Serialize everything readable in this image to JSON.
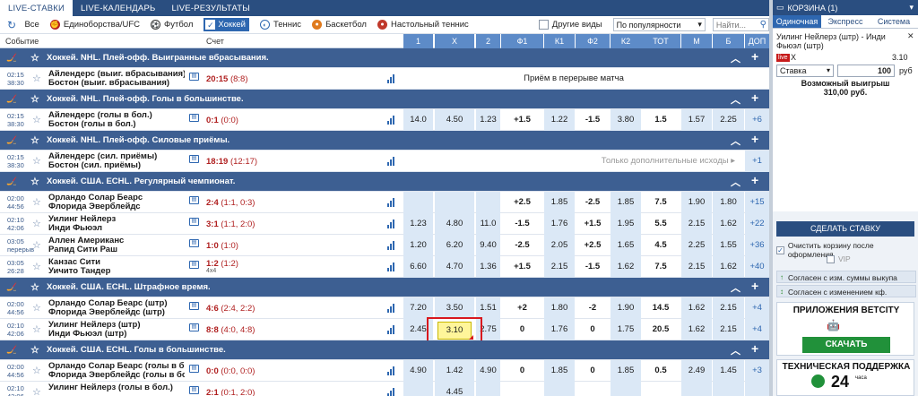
{
  "topnav": {
    "tabs": [
      "LIVE-СТАВКИ",
      "LIVE-КАЛЕНДАРЬ",
      "LIVE-РЕЗУЛЬТАТЫ"
    ]
  },
  "filters": {
    "items": [
      "Все",
      "Единоборства/UFC",
      "Футбол",
      "Хоккей",
      "Теннис",
      "Баскетбол",
      "Настольный теннис"
    ],
    "other": "Другие виды",
    "sort": "По популярности",
    "search_placeholder": "Найти..."
  },
  "columns": {
    "event": "Событие",
    "score": "Счет",
    "h": [
      "1",
      "X",
      "2",
      "Ф1",
      "К1",
      "Ф2",
      "К2",
      "ТОТ",
      "М",
      "Б",
      "ДОП"
    ]
  },
  "rows": [
    {
      "kind": "league",
      "name": "Хоккей. NHL. Плей-офф. Выигранные вбрасывания."
    },
    {
      "kind": "match",
      "t1": "02:15",
      "t2": "38:30",
      "a": "Айлендерс (выиг. вбрасывания)",
      "b": "Бостон (выиг. вбрасывания)",
      "score": "20:15",
      "sub": "(8:8)",
      "msg": "Приём в перерыве матча"
    },
    {
      "kind": "league",
      "name": "Хоккей. NHL. Плей-офф. Голы в большинстве."
    },
    {
      "kind": "match",
      "t1": "02:15",
      "t2": "38:30",
      "a": "Айлендерс (голы в бол.)",
      "b": "Бостон (голы в бол.)",
      "score": "0:1",
      "sub": "(0:0)",
      "odds": [
        "14.0",
        "4.50",
        "1.23",
        "+1.5",
        "1.22",
        "-1.5",
        "3.80",
        "1.5",
        "1.57",
        "2.25",
        "+6"
      ]
    },
    {
      "kind": "league",
      "name": "Хоккей. NHL. Плей-офф. Силовые приёмы."
    },
    {
      "kind": "match",
      "t1": "02:15",
      "t2": "38:30",
      "a": "Айлендерс (сил. приёмы)",
      "b": "Бостон (сил. приёмы)",
      "score": "18:19",
      "sub": "(12:17)",
      "more": "Только дополнительные исходы ▸",
      "extra": "+1"
    },
    {
      "kind": "league",
      "name": "Хоккей. США. ECHL. Регулярный чемпионат."
    },
    {
      "kind": "match",
      "t1": "02:00",
      "t2": "44:56",
      "a": "Орландо Солар Беарс",
      "b": "Флорида Эверблейдс",
      "score": "2:4",
      "sub": "(1:1, 0:3)",
      "odds": [
        "",
        "",
        "",
        "+2.5",
        "1.85",
        "-2.5",
        "1.85",
        "7.5",
        "1.90",
        "1.80",
        "+15"
      ]
    },
    {
      "kind": "match",
      "t1": "02:10",
      "t2": "42:06",
      "a": "Уилинг Нейлерз",
      "b": "Инди Фьюэл",
      "score": "3:1",
      "sub": "(1:1, 2:0)",
      "odds": [
        "1.23",
        "4.80",
        "11.0",
        "-1.5",
        "1.76",
        "+1.5",
        "1.95",
        "5.5",
        "2.15",
        "1.62",
        "+22"
      ]
    },
    {
      "kind": "match",
      "t1": "03:05",
      "t2": "перерыв",
      "a": "Аллен Американс",
      "b": "Рапид Сити Раш",
      "score": "1:0",
      "sub": "(1:0)",
      "odds": [
        "1.20",
        "6.20",
        "9.40",
        "-2.5",
        "2.05",
        "+2.5",
        "1.65",
        "4.5",
        "2.25",
        "1.55",
        "+36"
      ]
    },
    {
      "kind": "match",
      "t1": "03:05",
      "t2": "26:28",
      "a": "Канзас Сити",
      "b": "Уичито Тандер",
      "score": "1:2",
      "sub": "(1:2)",
      "score2": "4x4",
      "odds": [
        "6.60",
        "4.70",
        "1.36",
        "+1.5",
        "2.15",
        "-1.5",
        "1.62",
        "7.5",
        "2.15",
        "1.62",
        "+40"
      ]
    },
    {
      "kind": "league",
      "name": "Хоккей. США. ECHL. Штрафное время."
    },
    {
      "kind": "match",
      "t1": "02:00",
      "t2": "44:56",
      "a": "Орландо Солар Беарс (штр)",
      "b": "Флорида Эверблейдс (штр)",
      "score": "4:6",
      "sub": "(2:4, 2:2)",
      "odds": [
        "7.20",
        "3.50",
        "1.51",
        "+2",
        "1.80",
        "-2",
        "1.90",
        "14.5",
        "1.62",
        "2.15",
        "+4"
      ]
    },
    {
      "kind": "match",
      "t1": "02:10",
      "t2": "42:06",
      "a": "Уилинг Нейлерз (штр)",
      "b": "Инди Фьюэл (штр)",
      "score": "8:8",
      "sub": "(4:0, 4:8)",
      "odds": [
        "2.45",
        "3.10",
        "2.75",
        "0",
        "1.76",
        "0",
        "1.75",
        "20.5",
        "1.62",
        "2.15",
        "+4"
      ],
      "selected": 1
    },
    {
      "kind": "league",
      "name": "Хоккей. США. ECHL. Голы в большинстве."
    },
    {
      "kind": "match",
      "t1": "02:00",
      "t2": "44:56",
      "a": "Орландо Солар Беарс (голы в бол.)",
      "b": "Флорида Эверблейдс (голы в бол.)",
      "score": "0:0",
      "sub": "(0:0, 0:0)",
      "odds": [
        "4.90",
        "1.42",
        "4.90",
        "0",
        "1.85",
        "0",
        "1.85",
        "0.5",
        "2.49",
        "1.45",
        "+3"
      ]
    },
    {
      "kind": "match",
      "t1": "02:10",
      "t2": "42:06",
      "a": "Уилинг Нейлерз (голы в бол.)",
      "b": "",
      "score": "2:1",
      "sub": "(0:1, 2:0)",
      "odds": [
        "",
        "4.45",
        "",
        "",
        "",
        "",
        "",
        "",
        "",
        "",
        ""
      ]
    }
  ],
  "cart": {
    "title": "КОРЗИНА (1)",
    "tabs": [
      "Одиночная",
      "Экспресс",
      "Система"
    ],
    "selection": "Уилинг Нейлерз (штр) - Инди Фьюэл (штр)",
    "live": "live",
    "market": "X",
    "coef": "3.10",
    "stake_type": "Ставка",
    "stake": "100",
    "currency": "руб",
    "win_label": "Возможный выигрыш",
    "win_value": "310,00 руб.",
    "place": "СДЕЛАТЬ СТАВКУ",
    "clear": "Очистить корзину после оформления",
    "vip": "VIP",
    "agree1": "Согласен с изм. суммы выкупа",
    "agree2": "Согласен с изменением кф."
  },
  "apps": {
    "title": "ПРИЛОЖЕНИЯ BETCITY",
    "download": "СКАЧАТЬ"
  },
  "support": {
    "title": "ТЕХНИЧЕСКАЯ ПОДДЕРЖКА",
    "hours": "24",
    "hours_label": "часа"
  }
}
